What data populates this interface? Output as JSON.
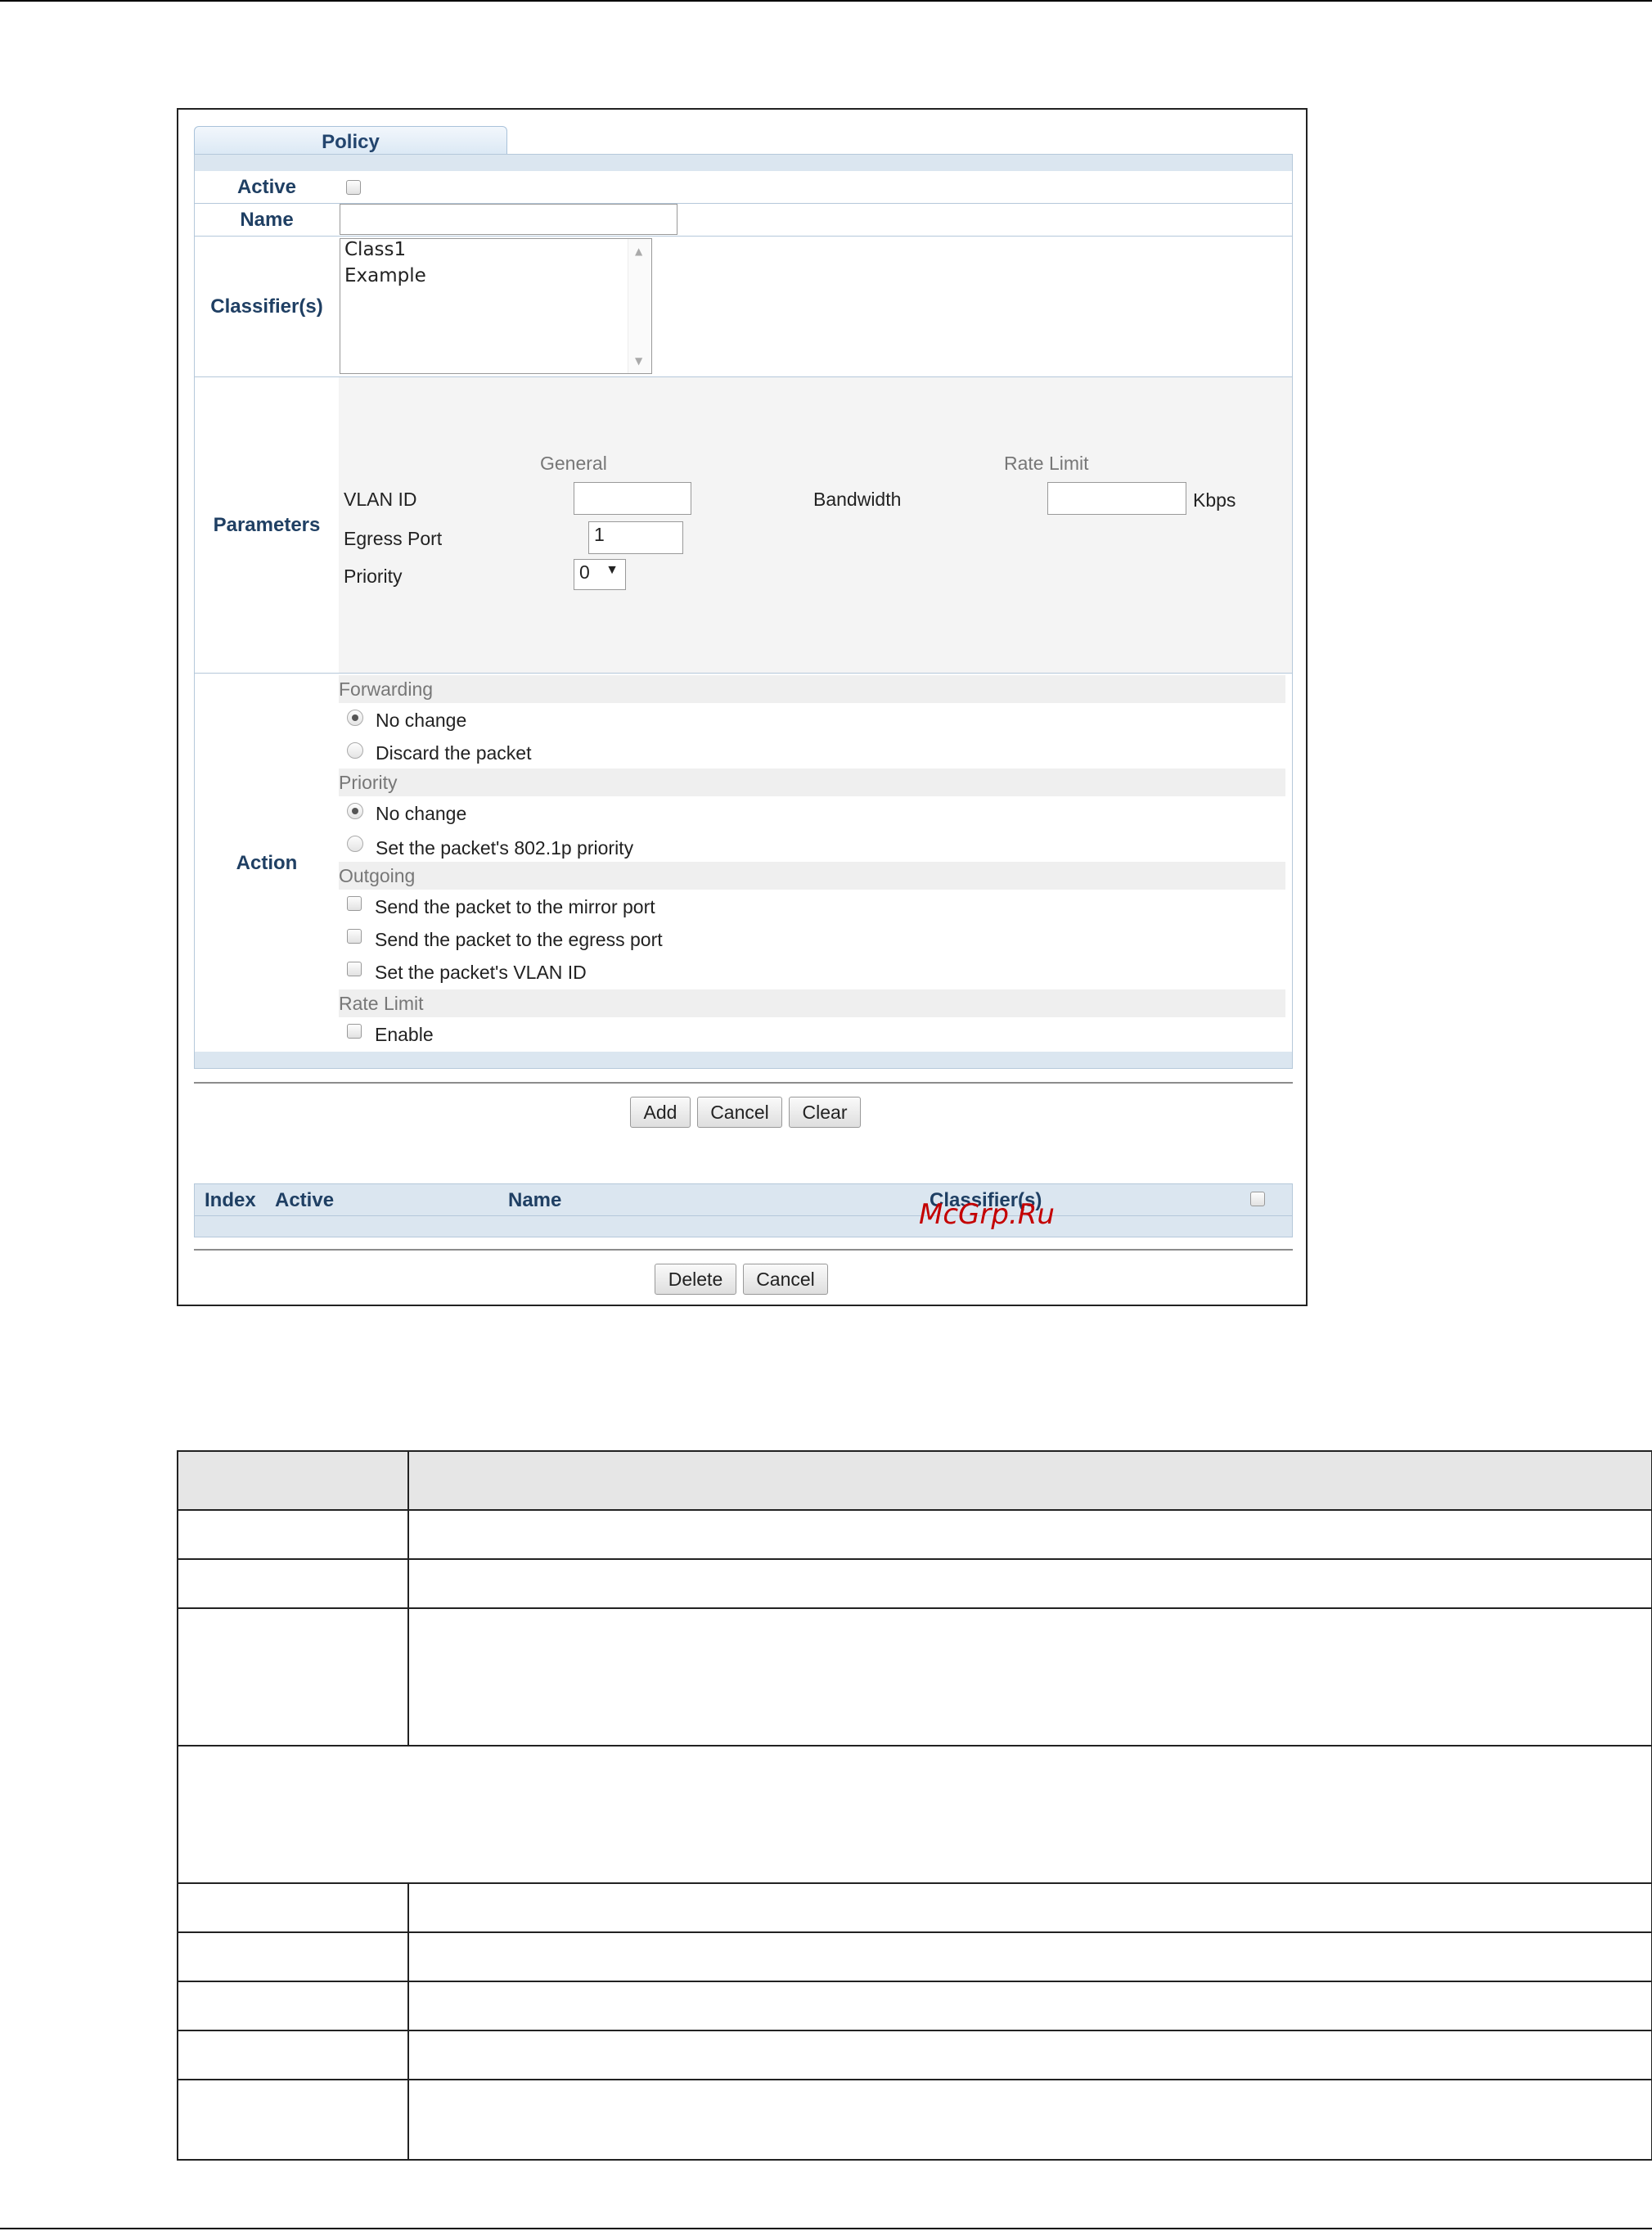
{
  "tab": {
    "label": "Policy"
  },
  "form": {
    "active": {
      "label": "Active",
      "checked": false
    },
    "name": {
      "label": "Name",
      "value": ""
    },
    "classifiers": {
      "label": "Classifier(s)",
      "options": [
        "Class1",
        "Example"
      ]
    },
    "parameters": {
      "label": "Parameters",
      "general_title": "General",
      "rate_limit_title": "Rate Limit",
      "vlan_id_label": "VLAN ID",
      "vlan_id_value": "",
      "egress_port_label": "Egress Port",
      "egress_port_value": "1",
      "priority_label": "Priority",
      "priority_value": "0",
      "bandwidth_label": "Bandwidth",
      "bandwidth_value": "",
      "bandwidth_unit": "Kbps"
    },
    "action": {
      "label": "Action",
      "forwarding": {
        "title": "Forwarding",
        "options": [
          "No change",
          "Discard the packet"
        ],
        "selected": 0
      },
      "priority": {
        "title": "Priority",
        "options": [
          "No change",
          "Set the packet's 802.1p priority"
        ],
        "selected": 0
      },
      "outgoing": {
        "title": "Outgoing",
        "options": [
          "Send the packet to the mirror port",
          "Send the packet to the egress port",
          "Set the packet's VLAN ID"
        ]
      },
      "rate_limit": {
        "title": "Rate Limit",
        "enable_label": "Enable"
      }
    }
  },
  "buttons": {
    "add": "Add",
    "cancel": "Cancel",
    "clear": "Clear",
    "delete": "Delete",
    "cancel2": "Cancel"
  },
  "policy_table": {
    "columns": [
      "Index",
      "Active",
      "Name",
      "Classifier(s)"
    ]
  },
  "watermark": "McGrp.Ru"
}
